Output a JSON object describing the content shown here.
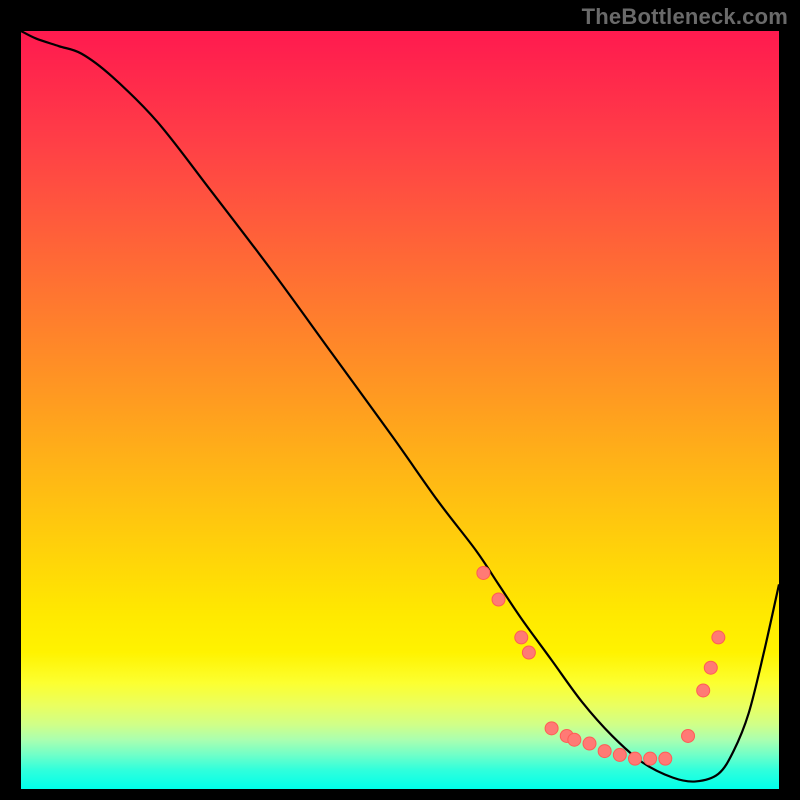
{
  "watermark": "TheBottleneck.com",
  "chart_data": {
    "type": "line",
    "title": "",
    "xlabel": "",
    "ylabel": "",
    "xlim": [
      0,
      100
    ],
    "ylim": [
      0,
      100
    ],
    "grid": false,
    "legend": false,
    "background_gradient": {
      "top": "#ff1a4f",
      "mid1": "#ff9c20",
      "mid2": "#ffe900",
      "near_bottom": "#fcff30",
      "bottom": "#00ffea"
    },
    "series": [
      {
        "name": "curve",
        "x": [
          0,
          2,
          5,
          8,
          12,
          18,
          25,
          33,
          41,
          49,
          55,
          60,
          63,
          66,
          70,
          74,
          78,
          82,
          86,
          89,
          92,
          94,
          96,
          98,
          100
        ],
        "y": [
          100,
          99,
          98,
          97,
          94,
          88,
          79,
          68.5,
          57.5,
          46.5,
          38,
          31.5,
          27,
          22.5,
          17,
          11.5,
          7,
          3.5,
          1.5,
          1,
          2,
          5,
          10,
          18,
          27
        ],
        "color": "#000000"
      }
    ],
    "scatter_points": [
      {
        "x": 61,
        "y": 28.5
      },
      {
        "x": 63,
        "y": 25
      },
      {
        "x": 66,
        "y": 20
      },
      {
        "x": 67,
        "y": 18
      },
      {
        "x": 70,
        "y": 8
      },
      {
        "x": 72,
        "y": 7
      },
      {
        "x": 73,
        "y": 6.5
      },
      {
        "x": 75,
        "y": 6
      },
      {
        "x": 77,
        "y": 5
      },
      {
        "x": 79,
        "y": 4.5
      },
      {
        "x": 81,
        "y": 4
      },
      {
        "x": 83,
        "y": 4
      },
      {
        "x": 85,
        "y": 4
      },
      {
        "x": 88,
        "y": 7
      },
      {
        "x": 90,
        "y": 13
      },
      {
        "x": 91,
        "y": 16
      },
      {
        "x": 92,
        "y": 20
      }
    ],
    "scatter_color": "#ff7a75"
  }
}
